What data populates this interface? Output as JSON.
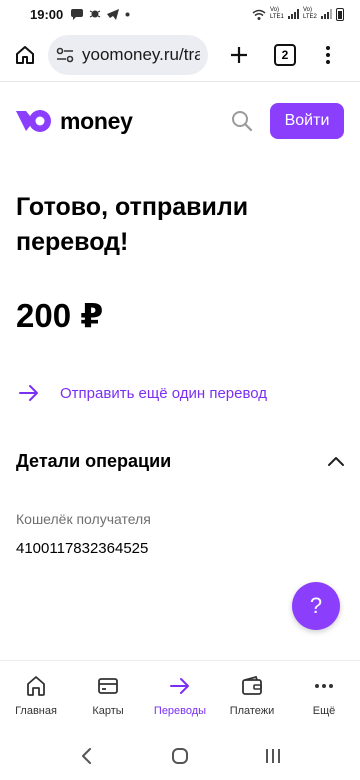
{
  "status_bar": {
    "time": "19:00",
    "carrier1": "Vo) LTE1",
    "carrier2": "Vo) LTE2"
  },
  "browser": {
    "url": "yoomoney.ru/tra",
    "tab_count": "2"
  },
  "header": {
    "logo_text": "money",
    "login_label": "Войти",
    "brand_color": "#8b3ffd"
  },
  "main": {
    "title": "Готово, отправили перевод!",
    "amount": "200 ₽",
    "send_again_label": "Отправить ещё один перевод",
    "details_title": "Детали операции",
    "recipient_label": "Кошелёк получателя",
    "recipient_value": "4100117832364525",
    "help_label": "?"
  },
  "bottom_nav": {
    "items": [
      {
        "label": "Главная",
        "icon": "home-icon"
      },
      {
        "label": "Карты",
        "icon": "card-icon"
      },
      {
        "label": "Переводы",
        "icon": "arrow-right-icon",
        "active": true
      },
      {
        "label": "Платежи",
        "icon": "wallet-icon"
      },
      {
        "label": "Ещё",
        "icon": "more-icon"
      }
    ]
  }
}
